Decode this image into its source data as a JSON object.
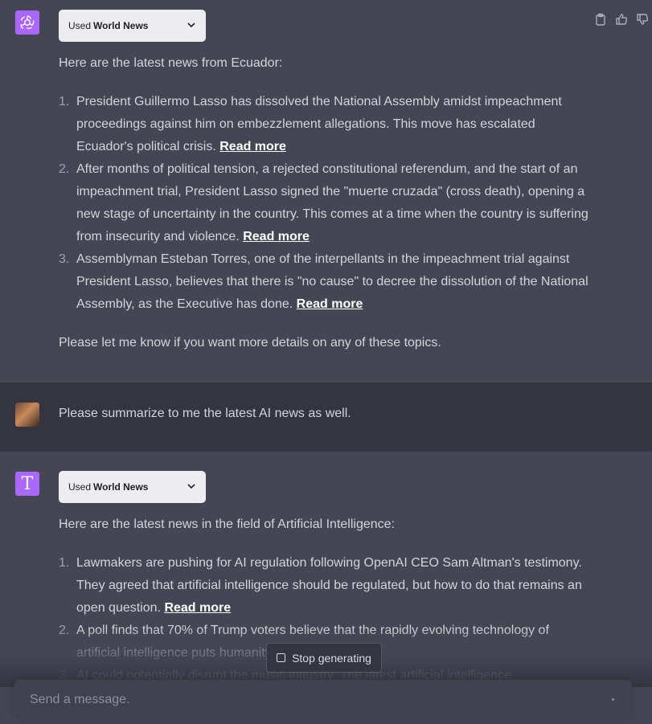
{
  "conversation": {
    "msg1": {
      "plugin": {
        "prefix": "Used",
        "name": "World News"
      },
      "intro": "Here are the latest news from Ecuador:",
      "items": [
        {
          "num": "1.",
          "text": "President Guillermo Lasso has dissolved the National Assembly amidst impeachment proceedings against him on embezzlement allegations. This move has escalated Ecuador's political crisis.",
          "link": "Read more"
        },
        {
          "num": "2.",
          "text": "After months of political tension, a rejected constitutional referendum, and the start of an impeachment trial, President Lasso signed the \"muerte cruzada\" (cross death), opening a new stage of uncertainty in the country. This comes at a time when the country is suffering from insecurity and violence.",
          "link": "Read more"
        },
        {
          "num": "3.",
          "text": "Assemblyman Esteban Torres, one of the interpellants in the impeachment trial against President Lasso, believes that there is \"no cause\" to decree the dissolution of the National Assembly, as the Executive has done.",
          "link": "Read more"
        }
      ],
      "outro": "Please let me know if you want more details on any of these topics."
    },
    "user_msg": {
      "text": "Please summarize to me the latest AI news as well."
    },
    "msg2": {
      "avatar_letter": "T",
      "plugin": {
        "prefix": "Used",
        "name": "World News"
      },
      "intro": "Here are the latest news in the field of Artificial Intelligence:",
      "items": [
        {
          "num": "1.",
          "text": "Lawmakers are pushing for AI regulation following OpenAI CEO Sam Altman's testimony. They agreed that artificial intelligence should be regulated, but how to do that remains an open question.",
          "link": "Read more"
        },
        {
          "num": "2.",
          "text": "A poll finds that 70% of Trump voters believe that the rapidly evolving technology of artificial intelligence puts humanity at risk.",
          "link": ""
        },
        {
          "num": "3.",
          "text": "AI could potentially disrupt the music industry. The latest artificial intelligence",
          "link": ""
        }
      ]
    }
  },
  "controls": {
    "stop_generating": "Stop generating",
    "input_placeholder": "Send a message."
  },
  "icons": {
    "copy": "clipboard-icon",
    "thumbs_up": "thumbs-up-icon",
    "thumbs_down": "thumbs-down-icon",
    "chevron": "chevron-down-icon",
    "stop": "stop-square-icon"
  },
  "colors": {
    "assistant_bg": "#444654",
    "user_bg": "#343541",
    "avatar_purple": "#ab68ff"
  }
}
